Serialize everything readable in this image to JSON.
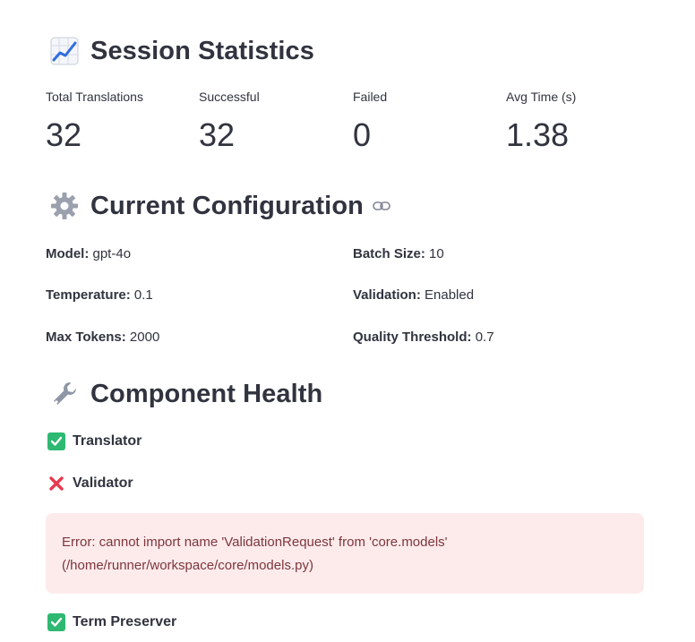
{
  "stats": {
    "heading": "Session Statistics",
    "heading_icon": "chart-increasing-icon",
    "metrics": [
      {
        "label": "Total Translations",
        "value": "32"
      },
      {
        "label": "Successful",
        "value": "32"
      },
      {
        "label": "Failed",
        "value": "0"
      },
      {
        "label": "Avg Time (s)",
        "value": "1.38"
      }
    ]
  },
  "config": {
    "heading": "Current Configuration",
    "heading_icon": "gear-icon",
    "items": [
      {
        "key": "Model:",
        "value": "gpt-4o"
      },
      {
        "key": "Batch Size:",
        "value": "10"
      },
      {
        "key": "Temperature:",
        "value": "0.1"
      },
      {
        "key": "Validation:",
        "value": "Enabled"
      },
      {
        "key": "Max Tokens:",
        "value": "2000"
      },
      {
        "key": "Quality Threshold:",
        "value": "0.7"
      }
    ]
  },
  "health": {
    "heading": "Component Health",
    "heading_icon": "wrench-icon",
    "components": [
      {
        "name": "Translator",
        "status": "ok"
      },
      {
        "name": "Validator",
        "status": "error"
      },
      {
        "name": "Term Preserver",
        "status": "ok"
      }
    ],
    "error_line1": "Error: cannot import name 'ValidationRequest' from 'core.models'",
    "error_line2": "(/home/runner/workspace/core/models.py)"
  },
  "colors": {
    "ok": "#2eb872",
    "error": "#e8384f",
    "error_bg": "#fdebec",
    "error_text": "#7d353b"
  }
}
